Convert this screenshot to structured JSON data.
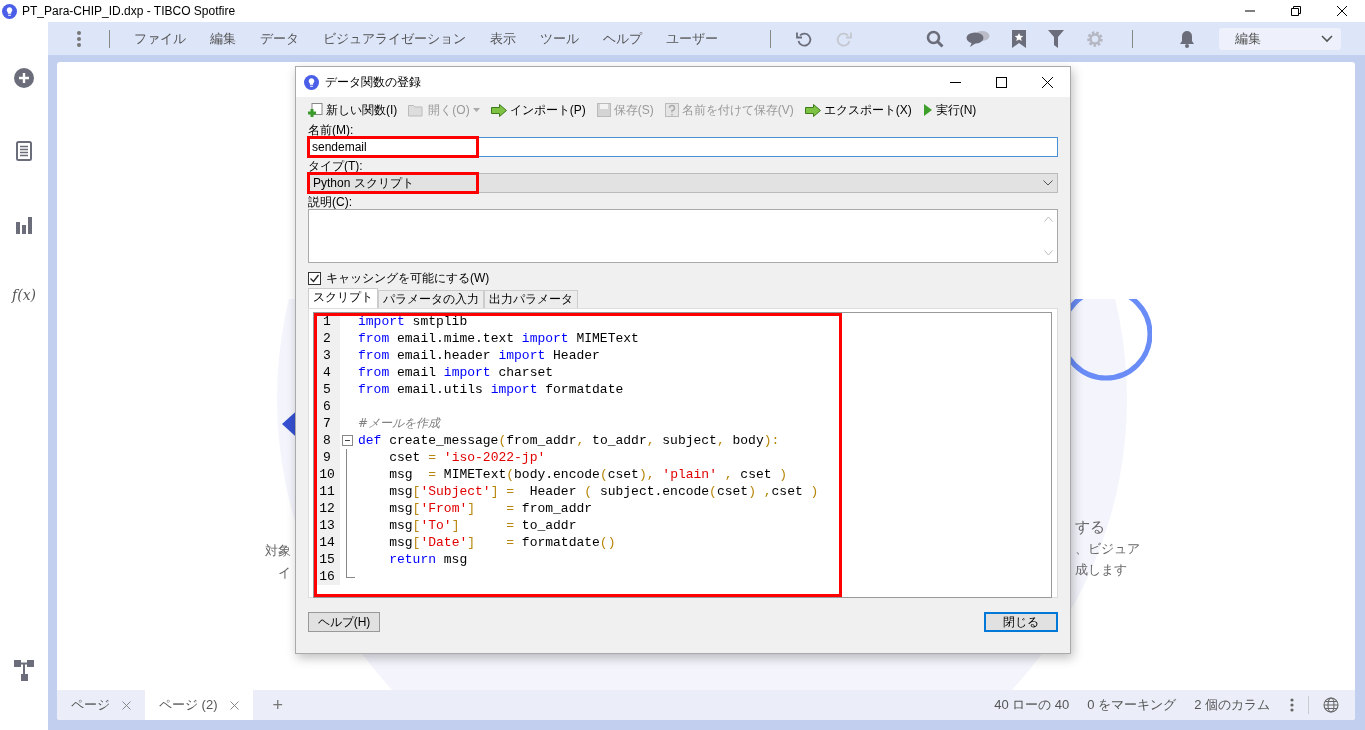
{
  "window": {
    "title": "PT_Para-CHIP_ID.dxp - TIBCO Spotfire"
  },
  "sidebar": {
    "function_label": "f(x)"
  },
  "menu": [
    {
      "label": "ファイル"
    },
    {
      "label": "編集"
    },
    {
      "label": "データ"
    },
    {
      "label": "ビジュアライゼーション"
    },
    {
      "label": "表示"
    },
    {
      "label": "ツール"
    },
    {
      "label": "ヘルプ"
    },
    {
      "label": "ユーザー"
    }
  ],
  "history": [
    {
      "kind": "undo",
      "disabled": false
    },
    {
      "kind": "redo",
      "disabled": true
    }
  ],
  "toolbar_icons": [
    {
      "kind": "search",
      "disabled": false
    },
    {
      "kind": "chat",
      "disabled": false
    },
    {
      "kind": "bookmark",
      "disabled": false
    },
    {
      "kind": "filter",
      "disabled": false
    },
    {
      "kind": "gear",
      "disabled": true
    }
  ],
  "mode_dropdown": {
    "value": "編集"
  },
  "background_text": {
    "left": [
      "対象",
      "イ"
    ],
    "right": [
      "する",
      "、ビジュア",
      "成します"
    ]
  },
  "dialog": {
    "title": "データ関数の登録",
    "toolbar": [
      {
        "kind": "new",
        "label": "新しい関数(I)",
        "disabled": false,
        "dropdown": false
      },
      {
        "kind": "open",
        "label": "開く(O)",
        "disabled": true,
        "dropdown": true
      },
      {
        "kind": "import",
        "label": "インポート(P)",
        "disabled": false,
        "dropdown": false
      },
      {
        "kind": "save",
        "label": "保存(S)",
        "disabled": true,
        "dropdown": false
      },
      {
        "kind": "saveas",
        "label": "名前を付けて保存(V)",
        "disabled": true,
        "dropdown": false
      },
      {
        "kind": "export",
        "label": "エクスポート(X)",
        "disabled": false,
        "dropdown": false
      },
      {
        "kind": "run",
        "label": "実行(N)",
        "disabled": false,
        "dropdown": false
      }
    ],
    "name_field": {
      "label": "名前(M):",
      "value": "sendemail",
      "highlighted": true
    },
    "type_field": {
      "label": "タイプ(T):",
      "value": "Python スクリプト",
      "highlighted": true
    },
    "description_field": {
      "label": "説明(C):"
    },
    "caching": {
      "label": "キャッシングを可能にする(W)",
      "checked": true
    },
    "tabs": [
      {
        "label": "スクリプト",
        "selected": true
      },
      {
        "label": "パラメータの入力",
        "selected": false
      },
      {
        "label": "出力パラメータ",
        "selected": false
      }
    ],
    "code_highlighted": true,
    "code_lines": [
      {
        "number": "1",
        "kind": "plain",
        "tokens": [
          {
            "kind": "kw",
            "text": "import"
          },
          {
            "kind": "tx",
            "text": " smtplib"
          }
        ]
      },
      {
        "number": "2",
        "kind": "plain",
        "tokens": [
          {
            "kind": "kw",
            "text": "from"
          },
          {
            "kind": "tx",
            "text": " email.mime.text "
          },
          {
            "kind": "kw",
            "text": "import"
          },
          {
            "kind": "tx",
            "text": " MIMEText"
          }
        ]
      },
      {
        "number": "3",
        "kind": "plain",
        "tokens": [
          {
            "kind": "kw",
            "text": "from"
          },
          {
            "kind": "tx",
            "text": " email.header "
          },
          {
            "kind": "kw",
            "text": "import"
          },
          {
            "kind": "tx",
            "text": " Header"
          }
        ]
      },
      {
        "number": "4",
        "kind": "plain",
        "tokens": [
          {
            "kind": "kw",
            "text": "from"
          },
          {
            "kind": "tx",
            "text": " email "
          },
          {
            "kind": "kw",
            "text": "import"
          },
          {
            "kind": "tx",
            "text": " charset"
          }
        ]
      },
      {
        "number": "5",
        "kind": "plain",
        "tokens": [
          {
            "kind": "kw",
            "text": "from"
          },
          {
            "kind": "tx",
            "text": " email.utils "
          },
          {
            "kind": "kw",
            "text": "import"
          },
          {
            "kind": "tx",
            "text": " formatdate"
          }
        ]
      },
      {
        "number": "6",
        "kind": "plain"
      },
      {
        "number": "7",
        "kind": "plain",
        "tokens": [
          {
            "kind": "com",
            "text": "#メールを作成"
          }
        ]
      },
      {
        "number": "8",
        "kind": "fold_start",
        "tokens": [
          {
            "kind": "kw",
            "text": "def"
          },
          {
            "kind": "tx",
            "text": " create_message"
          },
          {
            "kind": "op",
            "text": "("
          },
          {
            "kind": "tx",
            "text": "from_addr"
          },
          {
            "kind": "op",
            "text": ", "
          },
          {
            "kind": "tx",
            "text": "to_addr"
          },
          {
            "kind": "op",
            "text": ", "
          },
          {
            "kind": "tx",
            "text": "subject"
          },
          {
            "kind": "op",
            "text": ", "
          },
          {
            "kind": "tx",
            "text": "body"
          },
          {
            "kind": "op",
            "text": "):"
          }
        ]
      },
      {
        "number": "9",
        "kind": "fold_body",
        "tokens": [
          {
            "kind": "tx",
            "text": "cset "
          },
          {
            "kind": "op",
            "text": "= "
          },
          {
            "kind": "str",
            "text": "'iso-2022-jp'"
          }
        ]
      },
      {
        "number": "10",
        "kind": "fold_body",
        "tokens": [
          {
            "kind": "tx",
            "text": "msg  "
          },
          {
            "kind": "op",
            "text": "="
          },
          {
            "kind": "tx",
            "text": " MIMEText"
          },
          {
            "kind": "op",
            "text": "("
          },
          {
            "kind": "tx",
            "text": "body.encode"
          },
          {
            "kind": "op",
            "text": "("
          },
          {
            "kind": "tx",
            "text": "cset"
          },
          {
            "kind": "op",
            "text": "), "
          },
          {
            "kind": "str",
            "text": "'plain'"
          },
          {
            "kind": "op",
            "text": " , "
          },
          {
            "kind": "tx",
            "text": "cset "
          },
          {
            "kind": "op",
            "text": ")"
          }
        ]
      },
      {
        "number": "11",
        "kind": "fold_body",
        "tokens": [
          {
            "kind": "tx",
            "text": "msg"
          },
          {
            "kind": "op",
            "text": "["
          },
          {
            "kind": "str",
            "text": "'Subject'"
          },
          {
            "kind": "op",
            "text": "] =  "
          },
          {
            "kind": "tx",
            "text": "Header "
          },
          {
            "kind": "op",
            "text": "( "
          },
          {
            "kind": "tx",
            "text": "subject.encode"
          },
          {
            "kind": "op",
            "text": "("
          },
          {
            "kind": "tx",
            "text": "cset"
          },
          {
            "kind": "op",
            "text": ") ,"
          },
          {
            "kind": "tx",
            "text": "cset "
          },
          {
            "kind": "op",
            "text": ")"
          }
        ]
      },
      {
        "number": "12",
        "kind": "fold_body",
        "tokens": [
          {
            "kind": "tx",
            "text": "msg"
          },
          {
            "kind": "op",
            "text": "["
          },
          {
            "kind": "str",
            "text": "'From'"
          },
          {
            "kind": "op",
            "text": "]    = "
          },
          {
            "kind": "tx",
            "text": "from_addr"
          }
        ]
      },
      {
        "number": "13",
        "kind": "fold_body",
        "tokens": [
          {
            "kind": "tx",
            "text": "msg"
          },
          {
            "kind": "op",
            "text": "["
          },
          {
            "kind": "str",
            "text": "'To'"
          },
          {
            "kind": "op",
            "text": "]      = "
          },
          {
            "kind": "tx",
            "text": "to_addr"
          }
        ]
      },
      {
        "number": "14",
        "kind": "fold_body",
        "tokens": [
          {
            "kind": "tx",
            "text": "msg"
          },
          {
            "kind": "op",
            "text": "["
          },
          {
            "kind": "str",
            "text": "'Date'"
          },
          {
            "kind": "op",
            "text": "]    = "
          },
          {
            "kind": "tx",
            "text": "formatdate"
          },
          {
            "kind": "op",
            "text": "()"
          }
        ]
      },
      {
        "number": "15",
        "kind": "fold_body",
        "tokens": [
          {
            "kind": "kw",
            "text": "return"
          },
          {
            "kind": "tx",
            "text": " msg"
          }
        ]
      },
      {
        "number": "16",
        "kind": "fold_end"
      }
    ],
    "help_button": "ヘルプ(H)",
    "close_button": "閉じる"
  },
  "page_tabs": [
    {
      "label": "ページ",
      "selected": false
    },
    {
      "label": "ページ (2)",
      "selected": true
    }
  ],
  "add_page": "+",
  "status": [
    "40 ローの 40",
    "0 をマーキング",
    "2 個のカラム"
  ]
}
